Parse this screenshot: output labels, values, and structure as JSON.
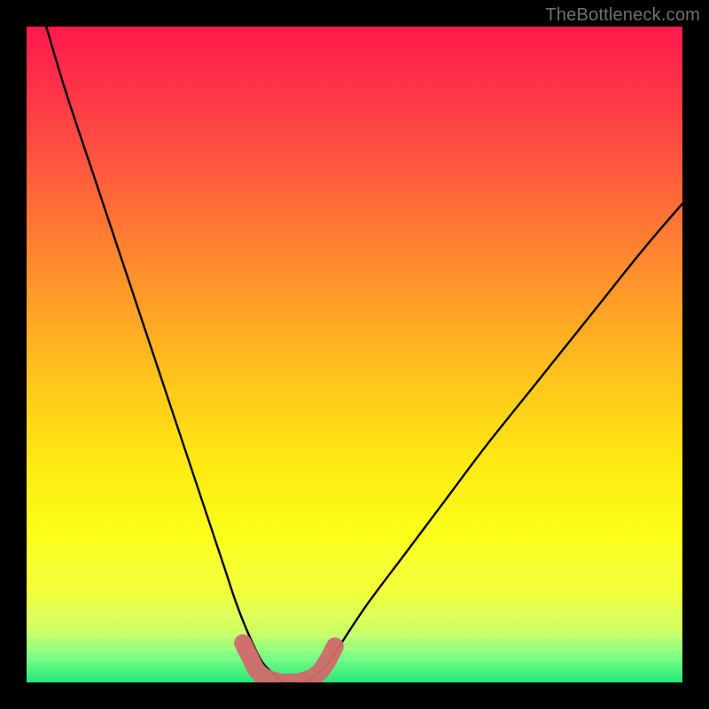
{
  "watermark": "TheBottleneck.com",
  "chart_data": {
    "type": "line",
    "title": "",
    "xlabel": "",
    "ylabel": "",
    "xlim": [
      0,
      100
    ],
    "ylim": [
      0,
      100
    ],
    "series": [
      {
        "name": "bottleneck-curve",
        "x": [
          3,
          6,
          10,
          14,
          18,
          22,
          26,
          30,
          32,
          34,
          36,
          38,
          39,
          40,
          42,
          44,
          46,
          48,
          52,
          58,
          64,
          70,
          78,
          86,
          94,
          100
        ],
        "y": [
          100,
          90,
          78,
          66,
          54,
          42,
          30,
          18,
          12,
          7,
          3,
          1,
          0,
          0,
          0,
          1,
          3,
          6,
          12,
          20,
          28,
          36,
          46,
          56,
          66,
          73
        ]
      },
      {
        "name": "bottom-marker-band",
        "x": [
          33,
          34,
          35,
          36,
          37,
          38,
          39,
          40,
          41,
          42,
          43,
          44,
          45,
          46,
          47
        ],
        "y": [
          6,
          4,
          2,
          1,
          0.5,
          0.2,
          0,
          0,
          0,
          0.2,
          0.5,
          1,
          2,
          3.5,
          5.5
        ]
      }
    ],
    "annotations": [],
    "legend": []
  }
}
